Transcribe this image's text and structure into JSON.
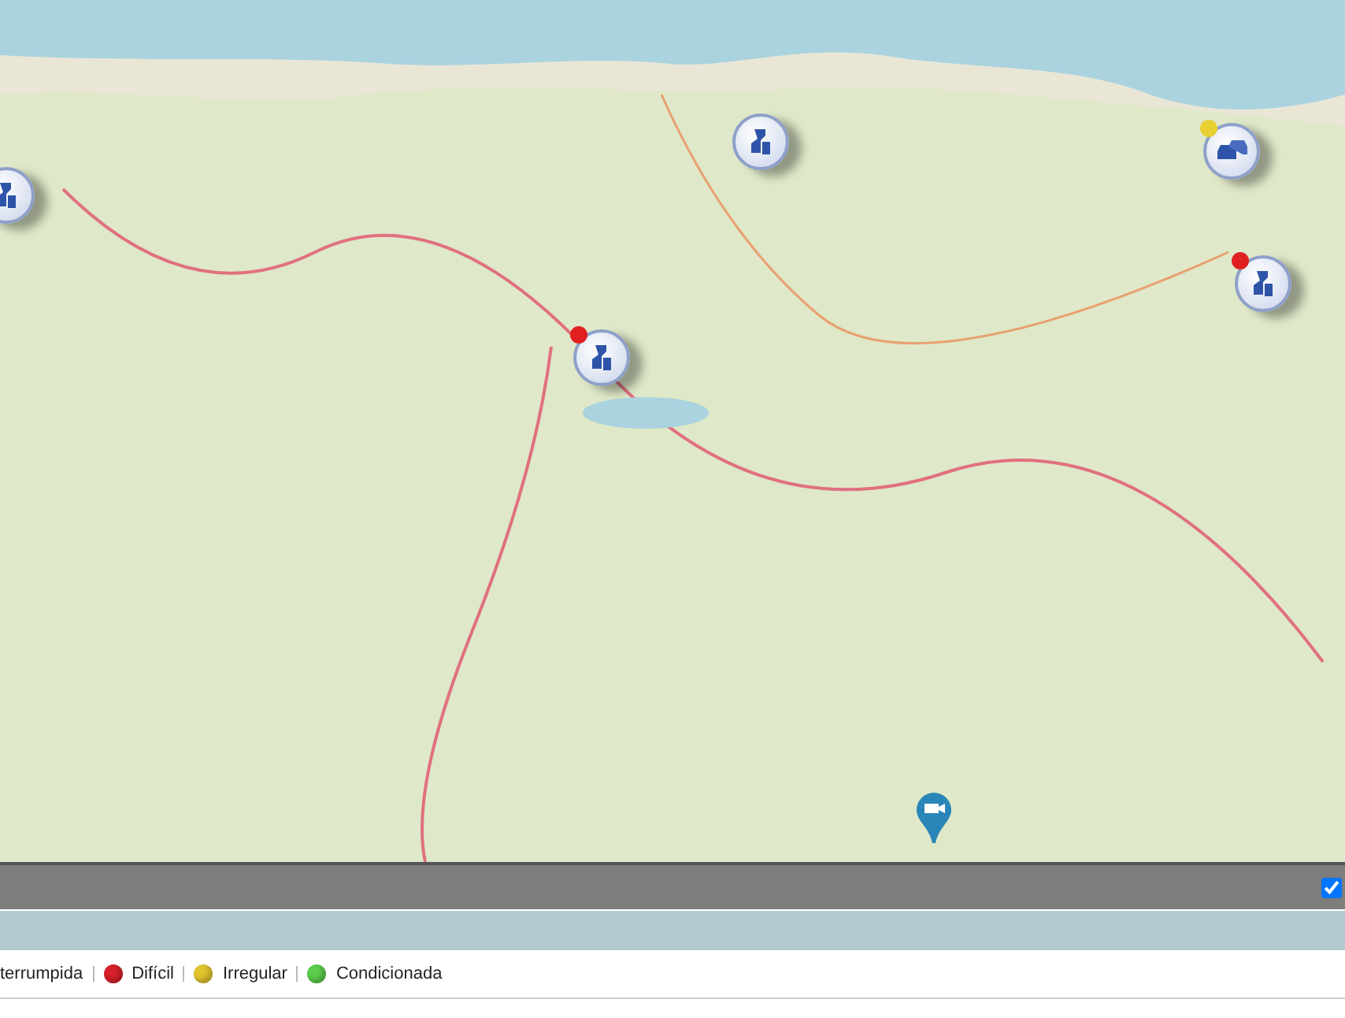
{
  "map": {
    "markers": [
      {
        "kind": "works"
      },
      {
        "kind": "works"
      },
      {
        "kind": "works",
        "color": "#e02020"
      },
      {
        "kind": "traffic",
        "color": "#e8d030"
      },
      {
        "kind": "works",
        "color": "#e02020"
      },
      {
        "kind": "camera"
      }
    ]
  },
  "toolbar": {
    "checkbox": {
      "checked": true
    }
  },
  "legend": [
    {
      "label": "terrumpida"
    },
    {
      "label": "Difícil",
      "color": "#d8202a"
    },
    {
      "label": "Irregular",
      "color": "#e2c430"
    },
    {
      "label": "Condicionada",
      "color": "#5ccc4c"
    }
  ]
}
